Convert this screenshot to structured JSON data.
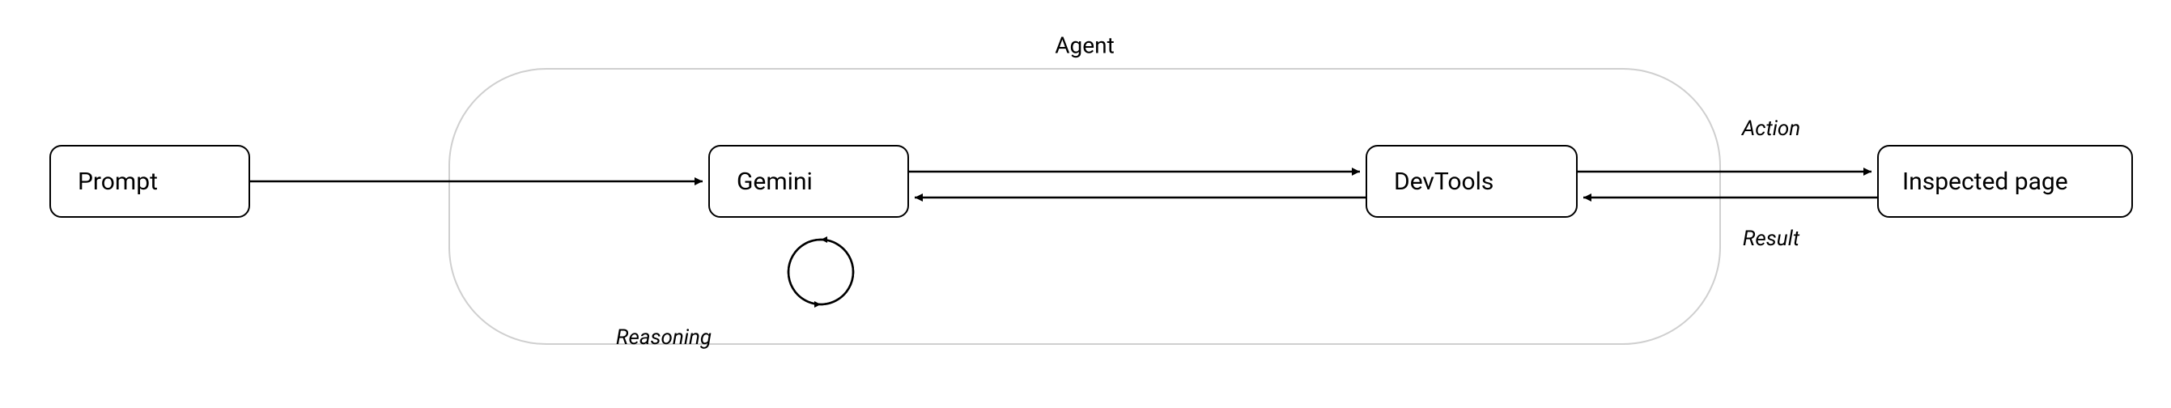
{
  "diagram": {
    "nodes": {
      "prompt": "Prompt",
      "gemini": "Gemini",
      "devtools": "DevTools",
      "inspected_page": "Inspected page"
    },
    "group": {
      "label": "Agent"
    },
    "edges": {
      "reasoning": "Reasoning",
      "action": "Action",
      "result": "Result"
    }
  }
}
